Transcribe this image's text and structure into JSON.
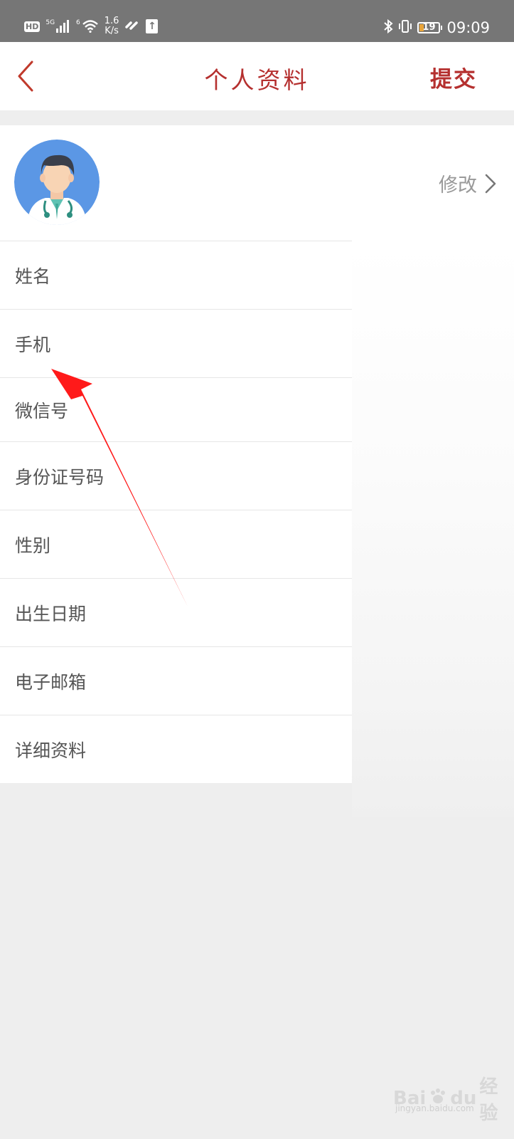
{
  "status_bar": {
    "hd_label": "HD",
    "signal_label": "5G",
    "wifi_label": "6",
    "speed_value": "1.6",
    "speed_unit": "K/s",
    "battery_level": "19",
    "time": "09:09",
    "battery_color": "#e9a53a"
  },
  "nav": {
    "title": "个人资料",
    "submit_label": "提交",
    "accent_color": "#b5302f"
  },
  "profile": {
    "modify_label": "修改"
  },
  "list": {
    "items": [
      {
        "label": "姓名"
      },
      {
        "label": "手机"
      },
      {
        "label": "微信号"
      },
      {
        "label": "身份证号码"
      },
      {
        "label": "性别"
      },
      {
        "label": "出生日期"
      },
      {
        "label": "电子邮箱"
      },
      {
        "label": "详细资料"
      }
    ]
  },
  "watermark": {
    "brand": "Bai",
    "brand_suffix": "du",
    "product": "经验",
    "domain": "jingyan.baidu.com"
  }
}
